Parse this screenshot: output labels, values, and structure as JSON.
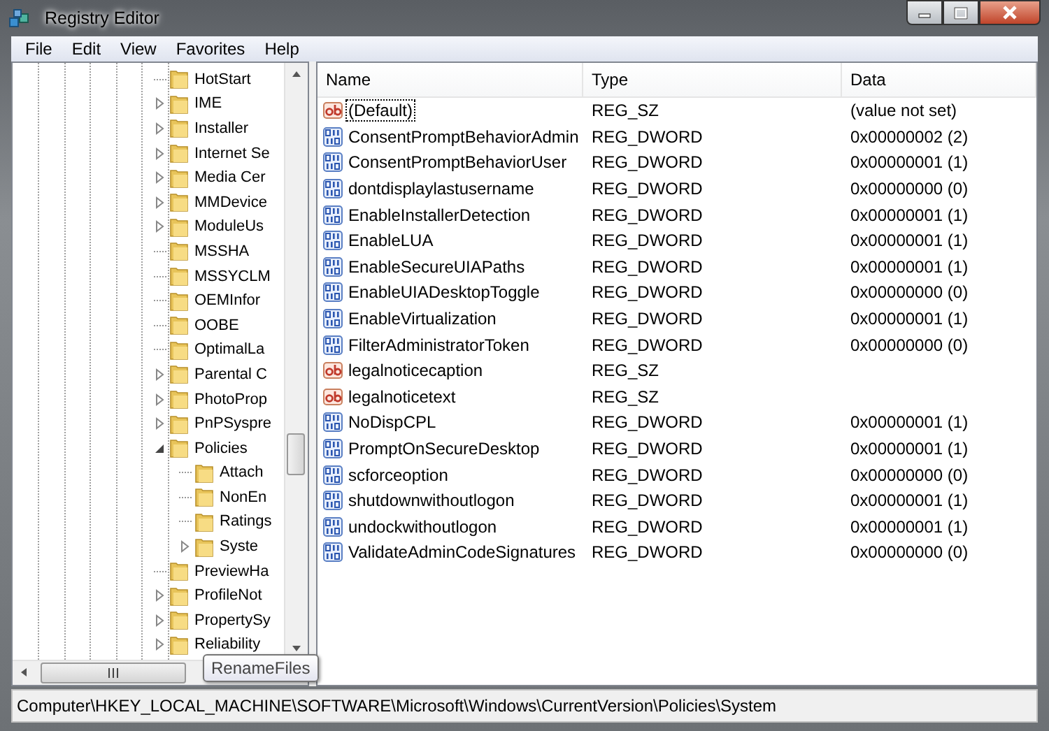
{
  "window": {
    "title": "Registry Editor"
  },
  "menu": [
    "File",
    "Edit",
    "View",
    "Favorites",
    "Help"
  ],
  "tree": [
    {
      "label": "HotStart",
      "expander": false
    },
    {
      "label": "IME",
      "expander": true,
      "expanded": false
    },
    {
      "label": "Installer",
      "expander": true,
      "expanded": false
    },
    {
      "label": "Internet Se",
      "expander": true,
      "expanded": false
    },
    {
      "label": "Media Cer",
      "expander": true,
      "expanded": false
    },
    {
      "label": "MMDevice",
      "expander": true,
      "expanded": false
    },
    {
      "label": "ModuleUs",
      "expander": true,
      "expanded": false
    },
    {
      "label": "MSSHA",
      "expander": false
    },
    {
      "label": "MSSYCLM",
      "expander": false
    },
    {
      "label": "OEMInfor",
      "expander": false
    },
    {
      "label": "OOBE",
      "expander": false
    },
    {
      "label": "OptimalLa",
      "expander": false
    },
    {
      "label": "Parental C",
      "expander": true,
      "expanded": false
    },
    {
      "label": "PhotoProp",
      "expander": true,
      "expanded": false
    },
    {
      "label": "PnPSyspre",
      "expander": true,
      "expanded": false
    },
    {
      "label": "Policies",
      "expander": true,
      "expanded": true,
      "children": [
        {
          "label": "Attach",
          "expander": false
        },
        {
          "label": "NonEn",
          "expander": false
        },
        {
          "label": "Ratings",
          "expander": false
        },
        {
          "label": "Syste",
          "expander": true,
          "expanded": false
        }
      ]
    },
    {
      "label": "PreviewHa",
      "expander": false
    },
    {
      "label": "ProfileNot",
      "expander": true,
      "expanded": false
    },
    {
      "label": "PropertySy",
      "expander": true,
      "expanded": false
    },
    {
      "label": "Reliability",
      "expander": true,
      "expanded": false
    }
  ],
  "tooltip": "RenameFiles",
  "table": {
    "columns": [
      "Name",
      "Type",
      "Data"
    ],
    "rows": [
      {
        "kind": "string",
        "name": "(Default)",
        "type": "REG_SZ",
        "data": "(value not set)",
        "focused": true
      },
      {
        "kind": "dword",
        "name": "ConsentPromptBehaviorAdmin",
        "type": "REG_DWORD",
        "data": "0x00000002 (2)",
        "focused": false
      },
      {
        "kind": "dword",
        "name": "ConsentPromptBehaviorUser",
        "type": "REG_DWORD",
        "data": "0x00000001 (1)",
        "focused": false
      },
      {
        "kind": "dword",
        "name": "dontdisplaylastusername",
        "type": "REG_DWORD",
        "data": "0x00000000 (0)",
        "focused": false
      },
      {
        "kind": "dword",
        "name": "EnableInstallerDetection",
        "type": "REG_DWORD",
        "data": "0x00000001 (1)",
        "focused": false
      },
      {
        "kind": "dword",
        "name": "EnableLUA",
        "type": "REG_DWORD",
        "data": "0x00000001 (1)",
        "focused": false
      },
      {
        "kind": "dword",
        "name": "EnableSecureUIAPaths",
        "type": "REG_DWORD",
        "data": "0x00000001 (1)",
        "focused": false
      },
      {
        "kind": "dword",
        "name": "EnableUIADesktopToggle",
        "type": "REG_DWORD",
        "data": "0x00000000 (0)",
        "focused": false
      },
      {
        "kind": "dword",
        "name": "EnableVirtualization",
        "type": "REG_DWORD",
        "data": "0x00000001 (1)",
        "focused": false
      },
      {
        "kind": "dword",
        "name": "FilterAdministratorToken",
        "type": "REG_DWORD",
        "data": "0x00000000 (0)",
        "focused": false
      },
      {
        "kind": "string",
        "name": "legalnoticecaption",
        "type": "REG_SZ",
        "focused": false
      },
      {
        "kind": "string",
        "name": "legalnoticetext",
        "type": "REG_SZ",
        "focused": false
      },
      {
        "kind": "dword",
        "name": "NoDispCPL",
        "type": "REG_DWORD",
        "data": "0x00000001 (1)",
        "focused": false
      },
      {
        "kind": "dword",
        "name": "PromptOnSecureDesktop",
        "type": "REG_DWORD",
        "data": "0x00000001 (1)",
        "focused": false
      },
      {
        "kind": "dword",
        "name": "scforceoption",
        "type": "REG_DWORD",
        "data": "0x00000000 (0)",
        "focused": false
      },
      {
        "kind": "dword",
        "name": "shutdownwithoutlogon",
        "type": "REG_DWORD",
        "data": "0x00000001 (1)",
        "focused": false
      },
      {
        "kind": "dword",
        "name": "undockwithoutlogon",
        "type": "REG_DWORD",
        "data": "0x00000001 (1)",
        "focused": false
      },
      {
        "kind": "dword",
        "name": "ValidateAdminCodeSignatures",
        "type": "REG_DWORD",
        "data": "0x00000000 (0)",
        "focused": false
      }
    ]
  },
  "status_bar": "Computer\\HKEY_LOCAL_MACHINE\\SOFTWARE\\Microsoft\\Windows\\CurrentVersion\\Policies\\System"
}
